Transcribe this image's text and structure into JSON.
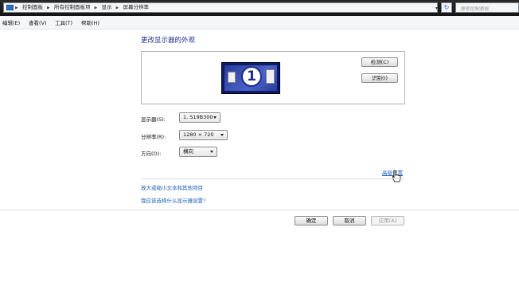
{
  "addressbar": {
    "crumbs": [
      "控制面板",
      "所有控制面板项",
      "显示",
      "屏幕分辨率"
    ],
    "search_placeholder": "搜索控制面板",
    "refresh_glyph": "↻"
  },
  "menu": {
    "items": [
      "编辑(E)",
      "查看(V)",
      "工具(T)",
      "帮助(H)"
    ]
  },
  "main": {
    "title": "更改显示器的外观",
    "monitor_number": "1",
    "detect_label": "检测(C)",
    "identify_label": "识别(I)"
  },
  "form": {
    "display_label": "显示器(S):",
    "display_value": "1. S19B300",
    "resolution_label": "分辨率(R):",
    "resolution_value": "1280 × 720",
    "orientation_label": "方向(O):",
    "orientation_value": "横向"
  },
  "links": {
    "advanced": "高级设置",
    "text_size": "放大或缩小文本和其他项目",
    "which_settings": "我应该选择什么显示器设置?"
  },
  "footer": {
    "ok": "确定",
    "cancel": "取消",
    "apply": "应用(A)"
  },
  "colors": {
    "title": "#1e3287",
    "link": "#1a5fb4",
    "monitor_frame": "#0a1a6e"
  }
}
